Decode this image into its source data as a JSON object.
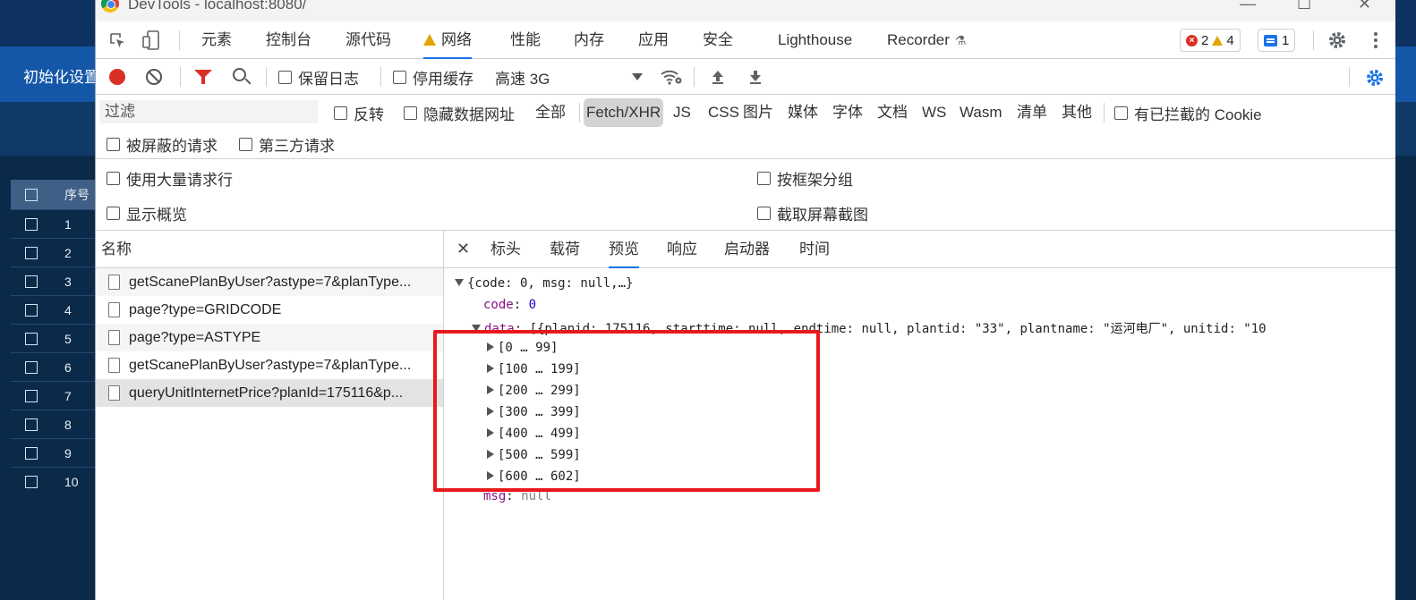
{
  "window": {
    "title": "DevTools - localhost:8080/"
  },
  "background_app": {
    "menu_label": "初始化设置",
    "table_header": "序号",
    "rows": [
      "1",
      "2",
      "3",
      "4",
      "5",
      "6",
      "7",
      "8",
      "9",
      "10"
    ]
  },
  "main_tabs": [
    {
      "label": "元素"
    },
    {
      "label": "控制台"
    },
    {
      "label": "源代码"
    },
    {
      "label": "网络",
      "active": true,
      "warning": true
    },
    {
      "label": "性能"
    },
    {
      "label": "内存"
    },
    {
      "label": "应用"
    },
    {
      "label": "安全"
    },
    {
      "label": "Lighthouse"
    },
    {
      "label": "Recorder"
    }
  ],
  "counts": {
    "errors": "2",
    "warnings": "4",
    "issues": "1"
  },
  "toolbar": {
    "preserve_log": "保留日志",
    "disable_cache": "停用缓存",
    "throttling": "高速 3G"
  },
  "filter": {
    "placeholder": "过滤",
    "invert": "反转",
    "hide_data_urls": "隐藏数据网址",
    "types": [
      "全部",
      "Fetch/XHR",
      "JS",
      "CSS",
      "图片",
      "媒体",
      "字体",
      "文档",
      "WS",
      "Wasm",
      "清单",
      "其他"
    ],
    "active_type": "Fetch/XHR",
    "blocked_cookies": "有已拦截的 Cookie",
    "blocked_requests": "被屏蔽的请求",
    "third_party": "第三方请求"
  },
  "options": {
    "big_rows": "使用大量请求行",
    "group_by_frame": "按框架分组",
    "show_overview": "显示概览",
    "capture_screenshots": "截取屏幕截图"
  },
  "requests": {
    "header": "名称",
    "items": [
      "getScanePlanByUser?astype=7&planType...",
      "page?type=GRIDCODE",
      "page?type=ASTYPE",
      "getScanePlanByUser?astype=7&planType...",
      "queryUnitInternetPrice?planId=175116&p..."
    ],
    "selected_index": 4
  },
  "detail_tabs": [
    "标头",
    "载荷",
    "预览",
    "响应",
    "启动器",
    "时间"
  ],
  "detail_active_tab": "预览",
  "preview": {
    "root": "{code: 0, msg: null,…}",
    "code_key": "code",
    "code_value": "0",
    "data_key": "data",
    "data_summary": "[{planid: 175116, starttime: null, endtime: null, plantid: \"33\", plantname: \"运河电厂\", unitid: \"10",
    "ranges": [
      "[0 … 99]",
      "[100 … 199]",
      "[200 … 299]",
      "[300 … 399]",
      "[400 … 499]",
      "[500 … 599]",
      "[600 … 602]"
    ],
    "msg_key": "msg",
    "msg_value": "null"
  },
  "colors": {
    "accent": "#1a73e8",
    "highlight": "#e8181c",
    "record": "#d93025"
  }
}
